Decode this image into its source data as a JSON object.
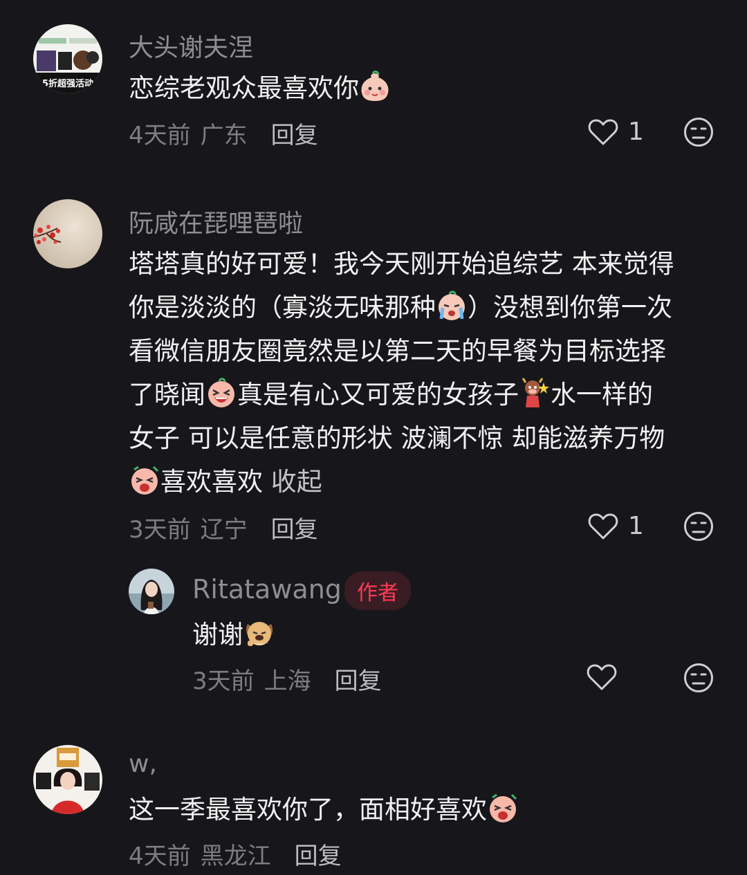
{
  "comments": [
    {
      "user": "大头谢夫涅",
      "avatar_text": "5折超强活动",
      "lines": [
        "恋综老观众最喜欢你"
      ],
      "time": "4天前",
      "location": "广东",
      "reply": "回复",
      "likes": "1"
    },
    {
      "user": "阮咸在琵哩琶啦",
      "lines": [
        "塔塔真的好可爱！我今天刚开始追综艺 本来觉得",
        "你是淡淡的（寡淡无味那种",
        "看微信朋友圈竟然是以第二天的早餐为目标选择",
        "了晓闻",
        "女子 可以是任意的形状 波澜不惊 却能滋养万物",
        "喜欢喜欢"
      ],
      "line_tails": {
        "l2": "）没想到你第一次",
        "l4a": "真是有心又可爱的女孩子",
        "l4b": "水一样的"
      },
      "collapse": "收起",
      "time": "3天前",
      "location": "辽宁",
      "reply": "回复",
      "likes": "1"
    },
    {
      "user": "Ritatawang",
      "badge": "作者",
      "lines": [
        "谢谢"
      ],
      "time": "3天前",
      "location": "上海",
      "reply": "回复"
    },
    {
      "user": "w,",
      "lines": [
        "这一季最喜欢你了，面相好喜欢"
      ],
      "time": "4天前",
      "location": "黑龙江",
      "reply": "回复"
    }
  ],
  "icons": {
    "like": "heart-outline-icon",
    "dislike": "meh-face-icon"
  },
  "colors": {
    "background": "#17171b",
    "username": "#8d8d92",
    "badge_text": "#ff3b55",
    "badge_bg": "#3a1d24"
  }
}
